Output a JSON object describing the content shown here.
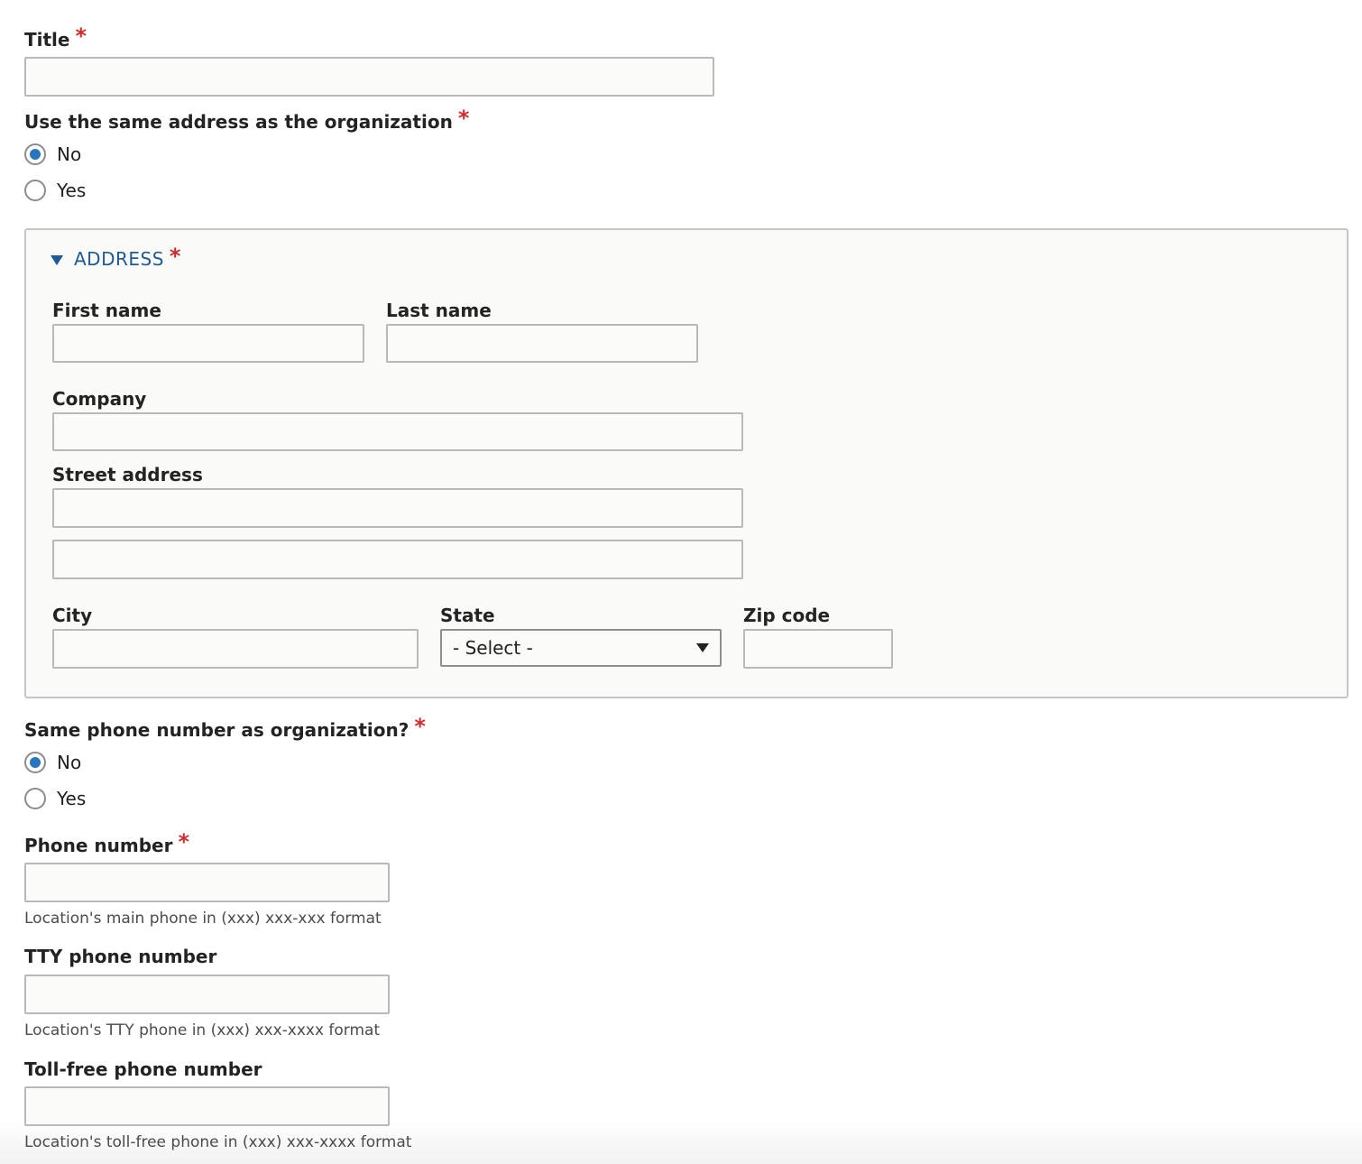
{
  "title_field": {
    "label": "Title",
    "required_mark": "*",
    "value": ""
  },
  "same_address": {
    "label": "Use the same address as the organization",
    "required_mark": "*",
    "options": [
      {
        "label": "No",
        "checked": true
      },
      {
        "label": "Yes",
        "checked": false
      }
    ]
  },
  "address": {
    "legend": "ADDRESS",
    "required_mark": "*",
    "first_name_label": "First name",
    "last_name_label": "Last name",
    "company_label": "Company",
    "street_label": "Street address",
    "city_label": "City",
    "state_label": "State",
    "state_value": "- Select -",
    "zip_label": "Zip code"
  },
  "same_phone": {
    "label": "Same phone number as organization?",
    "required_mark": "*",
    "options": [
      {
        "label": "No",
        "checked": true
      },
      {
        "label": "Yes",
        "checked": false
      }
    ]
  },
  "phone": {
    "label": "Phone number",
    "required_mark": "*",
    "help": "Location's main phone in (xxx) xxx-xxx format"
  },
  "tty": {
    "label": "TTY phone number",
    "help": "Location's TTY phone in (xxx) xxx-xxxx format"
  },
  "toll_free": {
    "label": "Toll-free phone number",
    "help": "Location's toll-free phone in (xxx) xxx-xxxx format"
  },
  "colors": {
    "required": "#d22b2b",
    "radio_selected": "#2a74c0",
    "legend": "#1e5a94"
  }
}
